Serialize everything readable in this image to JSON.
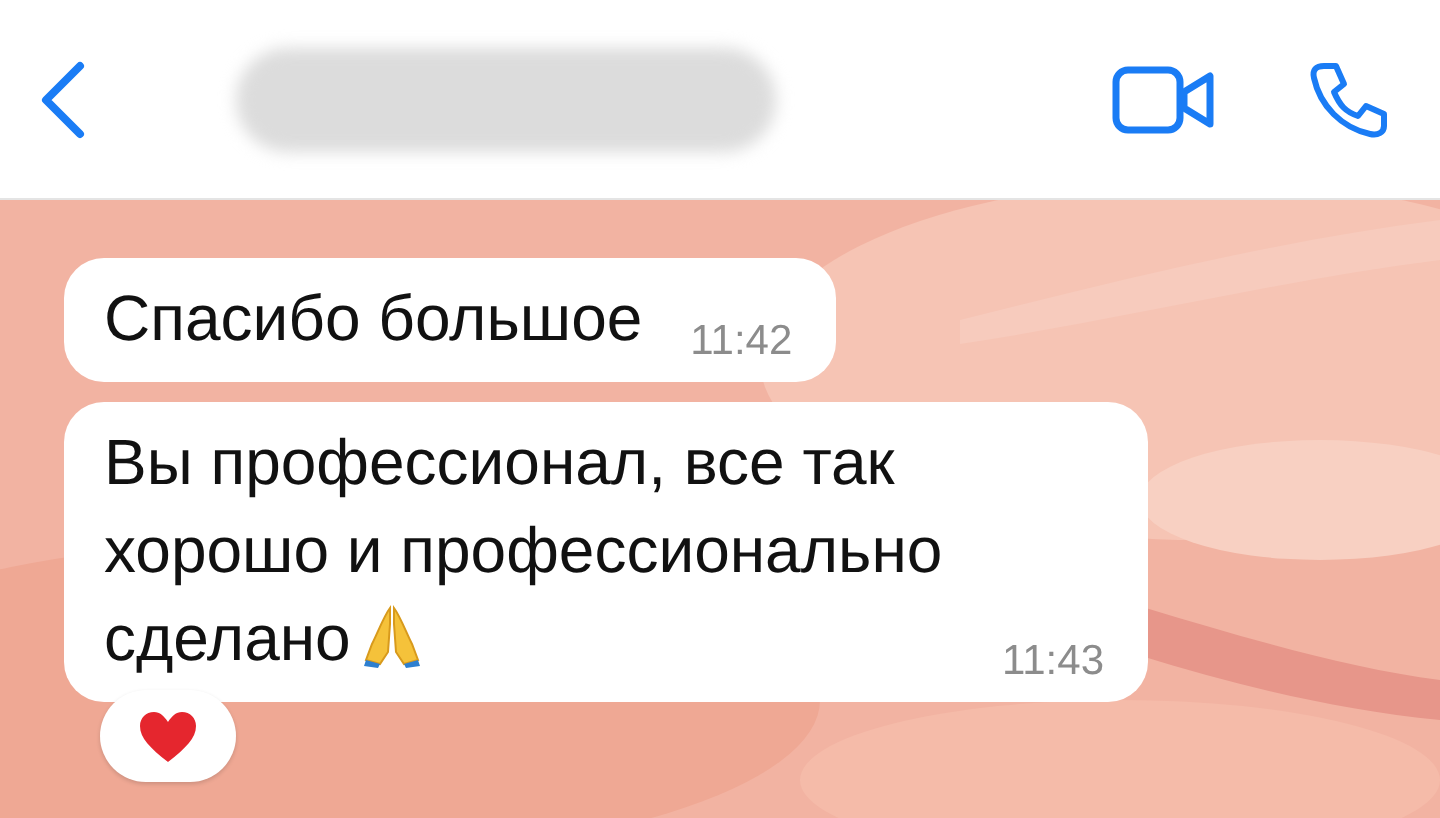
{
  "header": {
    "contact_name_redacted": true
  },
  "messages": [
    {
      "text": "Спасибо большое",
      "time": "11:42",
      "emoji": false,
      "reaction": false
    },
    {
      "text": "Вы профессионал, все так хорошо и профессионально сделано",
      "time": "11:43",
      "emoji": true,
      "reaction": true
    }
  ]
}
